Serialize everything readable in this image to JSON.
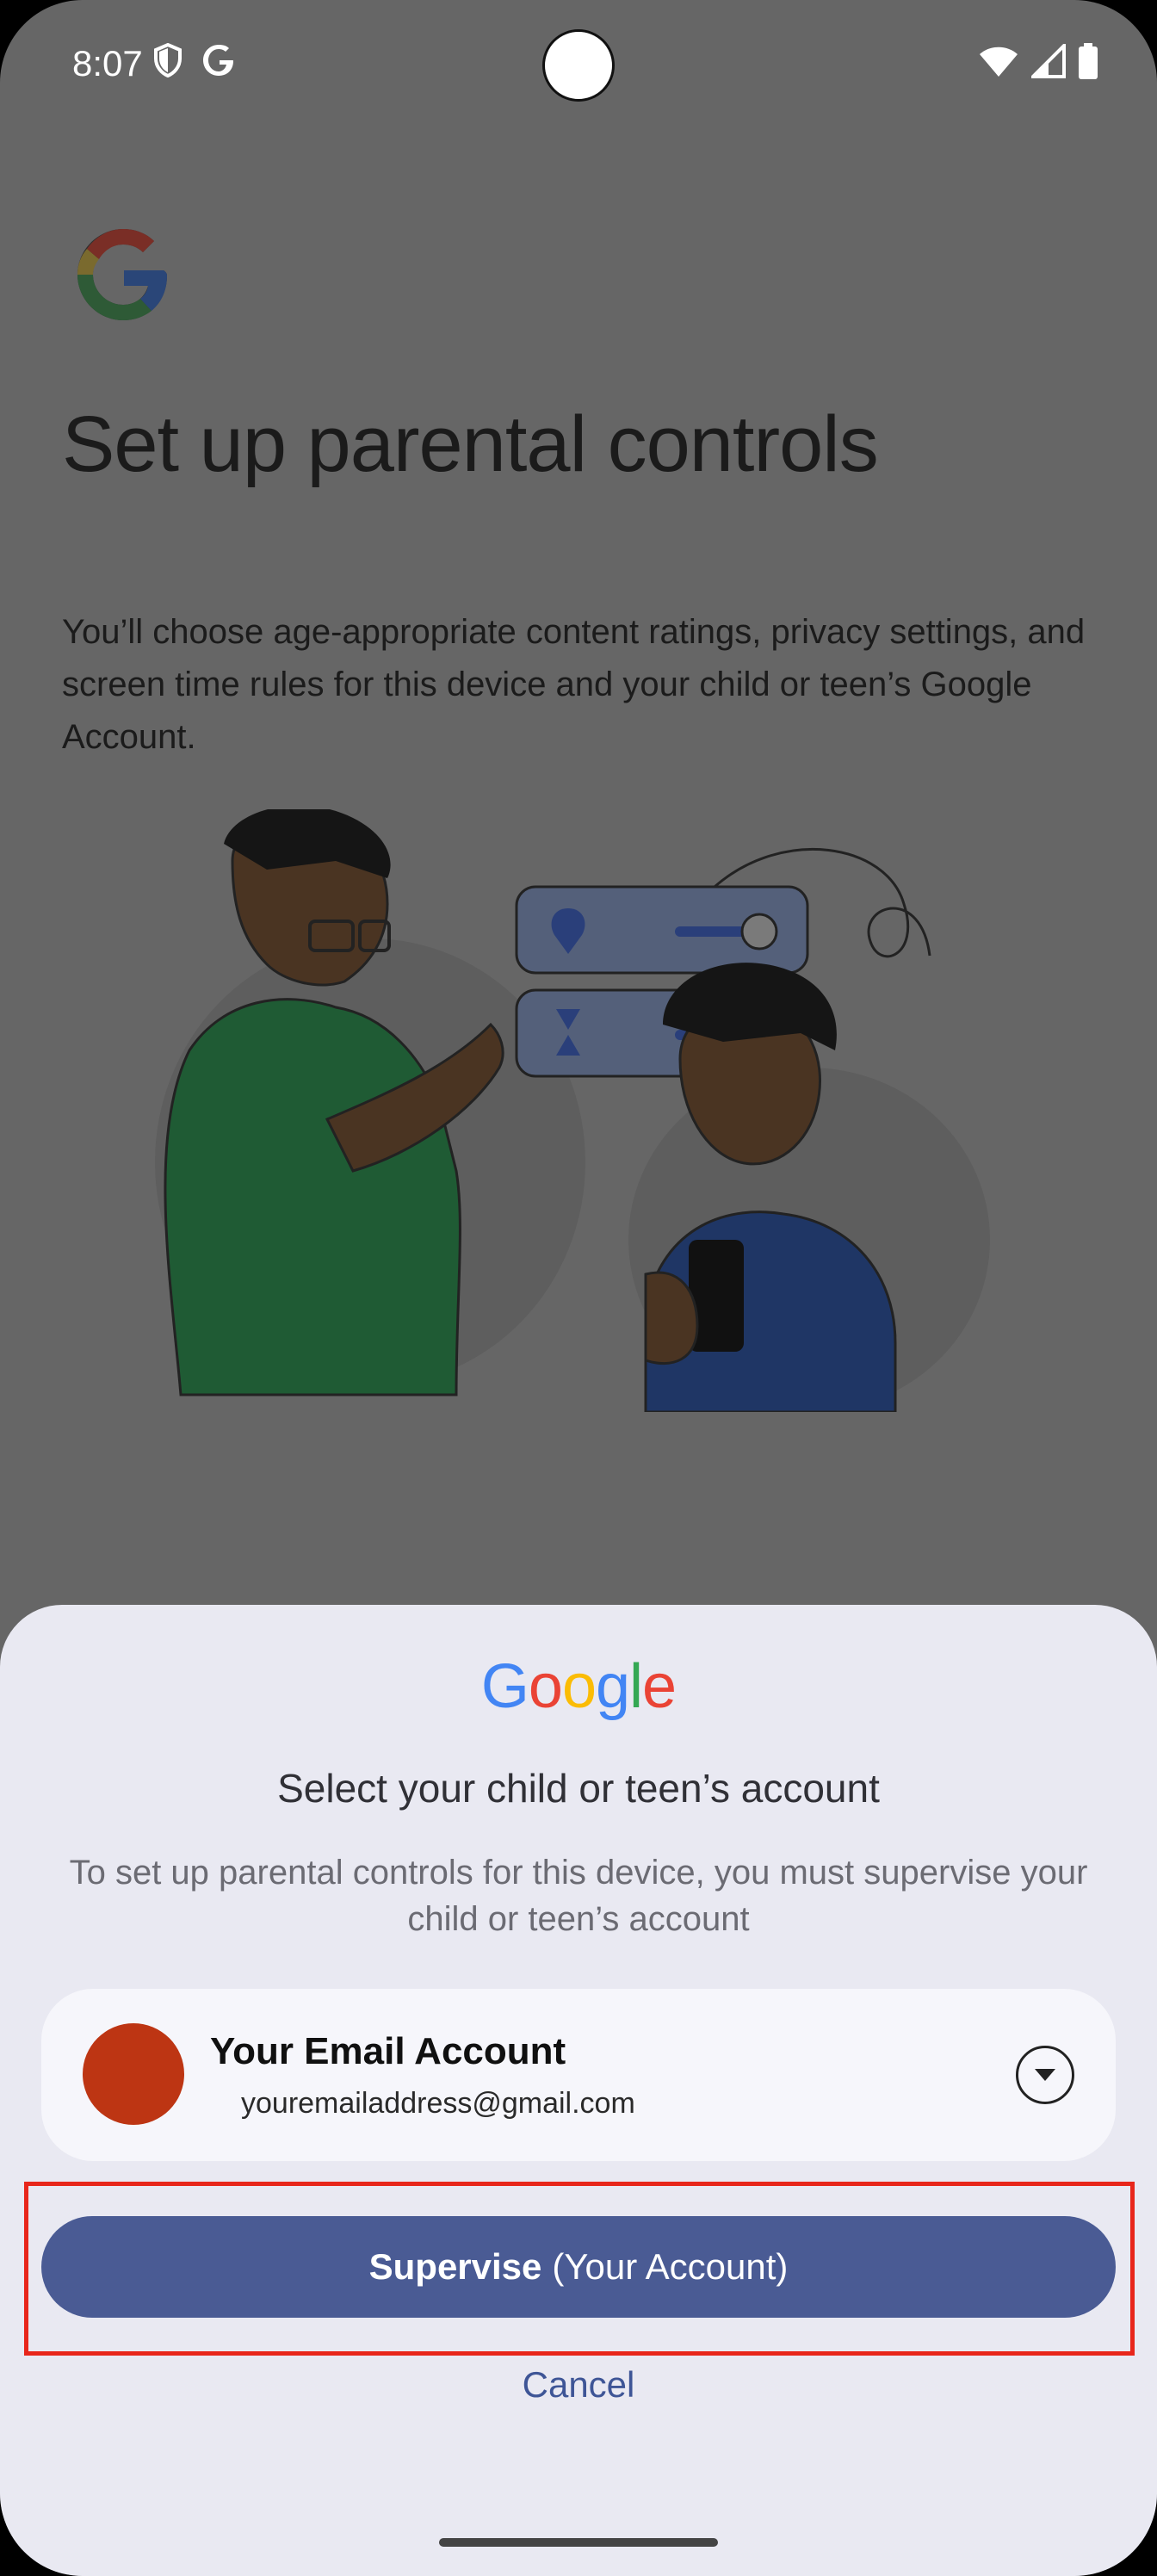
{
  "status_bar": {
    "time": "8:07",
    "left_icons": [
      "shield-icon",
      "google-g-icon"
    ],
    "right_icons": [
      "wifi-icon",
      "signal-icon",
      "battery-icon"
    ]
  },
  "background_page": {
    "title": "Set up parental controls",
    "description": "You’ll choose age-appropriate content ratings, privacy settings, and screen time rules for this device and your child or teen’s Google Account."
  },
  "sheet": {
    "brand": [
      "G",
      "o",
      "o",
      "g",
      "l",
      "e"
    ],
    "brand_colors": [
      "#4285f4",
      "#ea4335",
      "#fbbc05",
      "#4285f4",
      "#34a853",
      "#ea4335"
    ],
    "title": "Select your child or teen’s account",
    "description": "To set up parental controls for this device, you must supervise your child or teen’s account",
    "account": {
      "name": "Your Email Account",
      "email": "youremailaddress@gmail.com",
      "avatar_color": "#bd3513"
    },
    "primary_button": {
      "label_bold": "Supervise",
      "label_rest": "(Your Account)"
    },
    "cancel_label": "Cancel"
  },
  "colors": {
    "scrim": "#666666",
    "sheet_bg": "#e9e9f2",
    "button": "#4a5b94",
    "highlight": "#e8261b"
  }
}
